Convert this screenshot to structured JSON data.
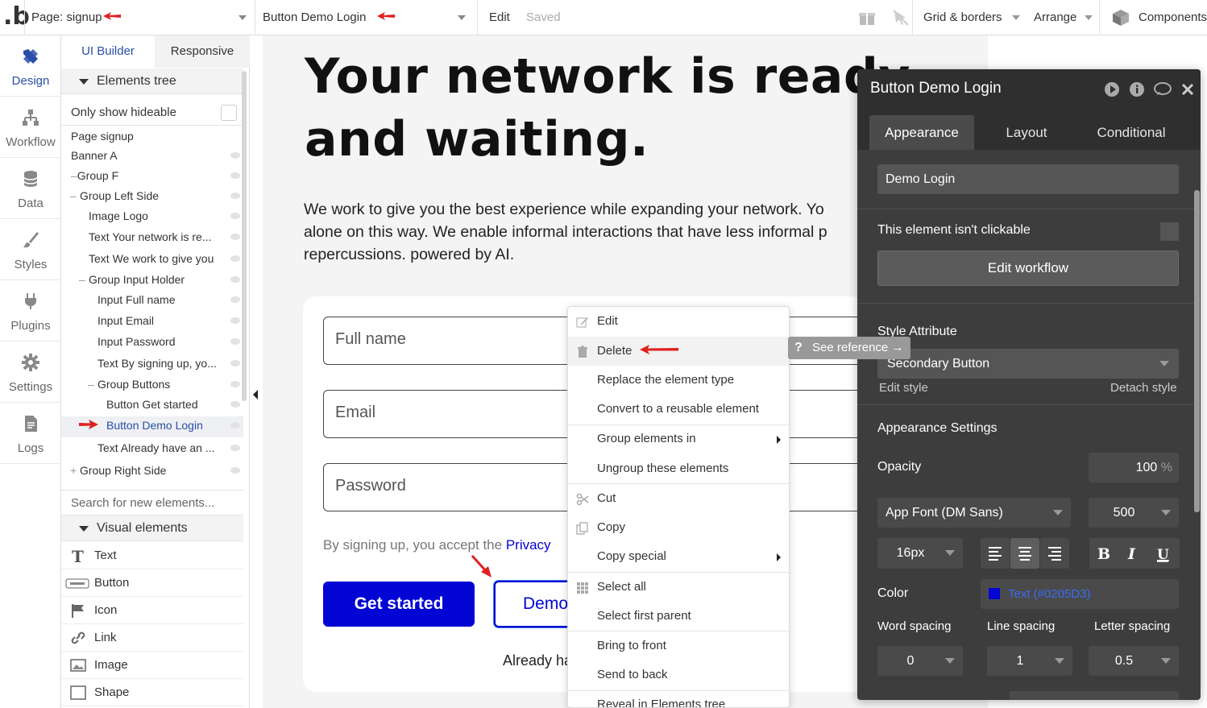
{
  "topbar": {
    "page_label": "Page: signup",
    "element_label": "Button Demo Login",
    "edit_label": "Edit",
    "saved_label": "Saved",
    "grid_label": "Grid & borders",
    "arrange_label": "Arrange",
    "components_label": "Components"
  },
  "rail": {
    "items": [
      {
        "label": "Design",
        "icon": "design-icon"
      },
      {
        "label": "Workflow",
        "icon": "workflow-icon"
      },
      {
        "label": "Data",
        "icon": "data-icon"
      },
      {
        "label": "Styles",
        "icon": "styles-icon"
      },
      {
        "label": "Plugins",
        "icon": "plugins-icon"
      },
      {
        "label": "Settings",
        "icon": "settings-icon"
      },
      {
        "label": "Logs",
        "icon": "logs-icon"
      }
    ]
  },
  "panel": {
    "tabs": [
      "UI Builder",
      "Responsive"
    ],
    "elements_tree_label": "Elements tree",
    "only_show_hideable": "Only show hideable",
    "tree": [
      {
        "label": "Page signup"
      },
      {
        "label": "Banner A"
      },
      {
        "label": "Group F",
        "prefix": "–"
      },
      {
        "label": "Group Left Side",
        "prefix": "–"
      },
      {
        "label": "Image Logo"
      },
      {
        "label": "Text Your network is re..."
      },
      {
        "label": "Text We work to give you"
      },
      {
        "label": "Group Input Holder",
        "prefix": "–"
      },
      {
        "label": "Input Full name"
      },
      {
        "label": "Input Email"
      },
      {
        "label": "Input Password"
      },
      {
        "label": "Text By signing up, yo..."
      },
      {
        "label": "Group Buttons",
        "prefix": "–"
      },
      {
        "label": "Button Get started"
      },
      {
        "label": "Button Demo Login"
      },
      {
        "label": "Text Already have an ..."
      },
      {
        "label": "Group Right Side",
        "prefix": "+"
      }
    ],
    "search_placeholder": "Search for new elements...",
    "visual_elements_label": "Visual elements",
    "visual_elements": [
      {
        "label": "Text",
        "icon": "text-icon"
      },
      {
        "label": "Button",
        "icon": "button-icon"
      },
      {
        "label": "Icon",
        "icon": "flag-icon"
      },
      {
        "label": "Link",
        "icon": "link-icon"
      },
      {
        "label": "Image",
        "icon": "image-icon"
      },
      {
        "label": "Shape",
        "icon": "shape-icon"
      }
    ]
  },
  "canvas": {
    "hero": "Your network is ready\nand waiting.",
    "lead": "We work to give you the best experience while expanding your network. Yo\nalone on this way. We enable informal interactions that have less informal p\nrepercussions. powered by AI.",
    "fields": [
      "Full name",
      "Email",
      "Password"
    ],
    "terms_prefix": "By signing up, you accept the ",
    "terms_link": "Privacy",
    "get_started": "Get started",
    "demo_login": "Demo",
    "already": "Already ha"
  },
  "context_menu": {
    "items": [
      {
        "label": "Edit",
        "icon": "edit-icon"
      },
      {
        "label": "Delete",
        "icon": "trash-icon"
      },
      {
        "label": "Replace the element type"
      },
      {
        "label": "Convert to a reusable element"
      },
      {
        "label": "Group elements in",
        "submenu": true
      },
      {
        "label": "Ungroup these elements"
      },
      {
        "label": "Cut",
        "icon": "cut-icon"
      },
      {
        "label": "Copy",
        "icon": "copy-icon"
      },
      {
        "label": "Copy special",
        "submenu": true
      },
      {
        "label": "Select all",
        "icon": "grid-icon"
      },
      {
        "label": "Select first parent"
      },
      {
        "label": "Bring to front"
      },
      {
        "label": "Send to back"
      },
      {
        "label": "Reveal in Elements tree"
      }
    ],
    "see_reference": "See reference →"
  },
  "property_editor": {
    "title": "Button Demo Login",
    "tabs": [
      "Appearance",
      "Layout",
      "Conditional"
    ],
    "element_name": "Demo Login",
    "not_clickable_label": "This element isn't clickable",
    "edit_workflow": "Edit workflow",
    "style_attribute_label": "Style Attribute",
    "style_value": "Secondary Button",
    "edit_style": "Edit style",
    "detach_style": "Detach style",
    "appearance_settings": "Appearance Settings",
    "opacity_label": "Opacity",
    "opacity_value": "100",
    "opacity_unit": "%",
    "font_family": "App Font (DM Sans)",
    "font_weight": "500",
    "font_size": "16px",
    "color_label": "Color",
    "color_value": "Text (#0205D3)",
    "color_swatch": "#0205d3",
    "word_spacing_label": "Word spacing",
    "line_spacing_label": "Line spacing",
    "letter_spacing_label": "Letter spacing",
    "word_spacing": "0",
    "line_spacing": "1",
    "letter_spacing": "0.5"
  },
  "colors": {
    "accent": "#2a4ea8",
    "brand_blue": "#0205d3",
    "annotation_red": "#e02020",
    "editor_bg": "#3d3d3d"
  }
}
